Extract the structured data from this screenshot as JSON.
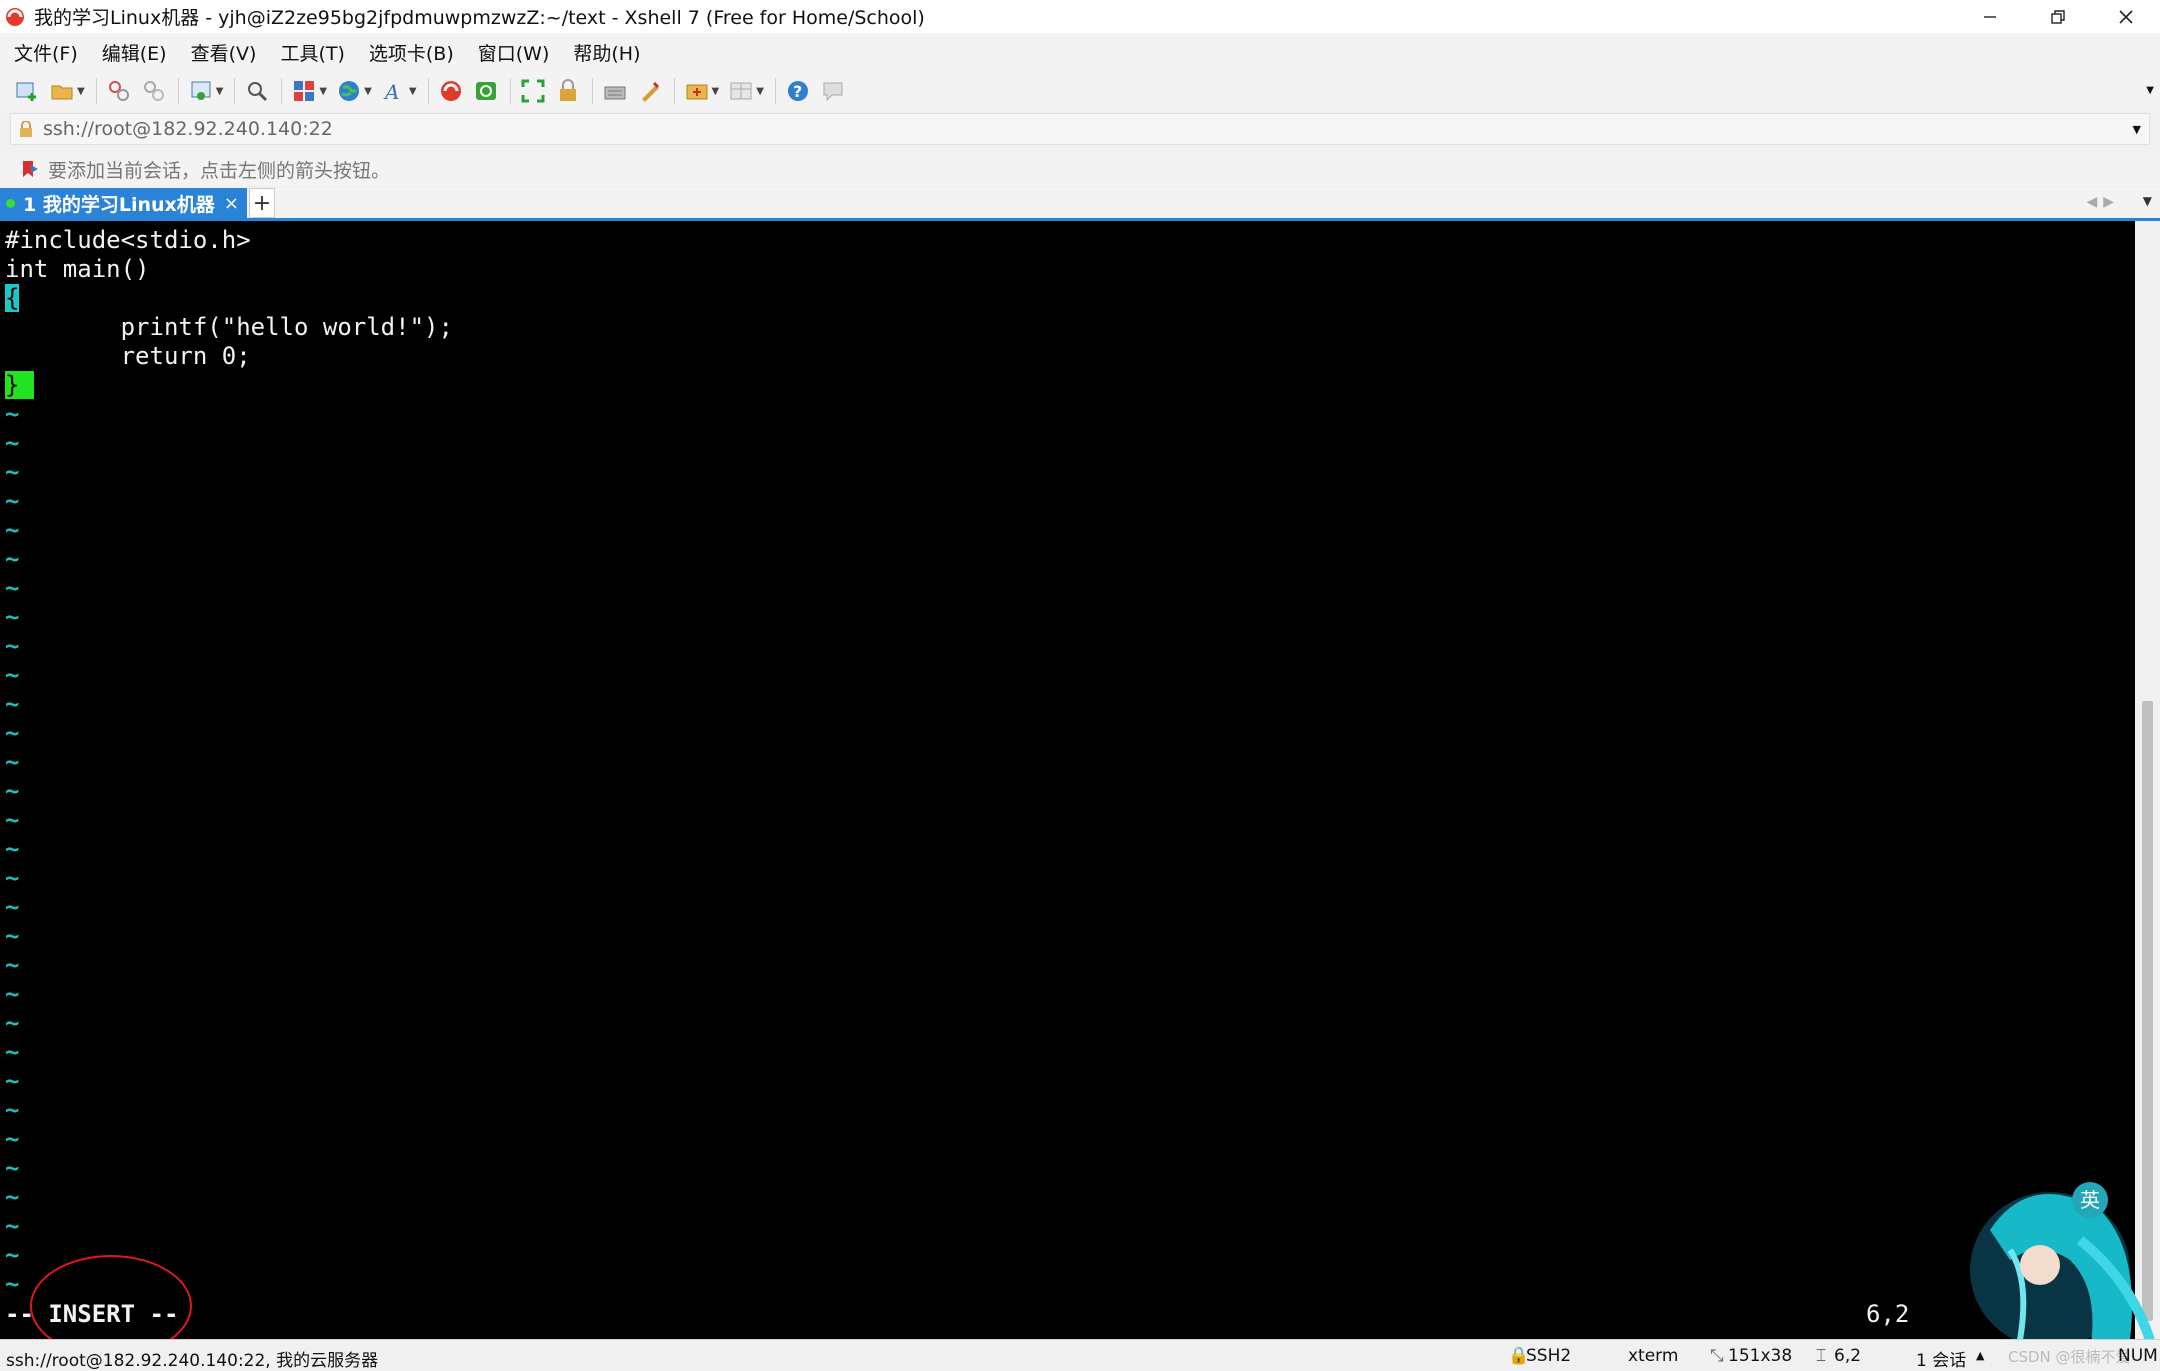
{
  "window": {
    "title": "我的学习Linux机器 - yjh@iZ2ze95bg2jfpdmuwpmzwzZ:~/text - Xshell 7 (Free for Home/School)"
  },
  "menu": [
    "文件(F)",
    "编辑(E)",
    "查看(V)",
    "工具(T)",
    "选项卡(B)",
    "窗口(W)",
    "帮助(H)"
  ],
  "address": {
    "value": "ssh://root@182.92.240.140:22"
  },
  "hint": {
    "text": "要添加当前会话，点击左侧的箭头按钮。"
  },
  "tab": {
    "label": "1 我的学习Linux机器",
    "close": "×",
    "add": "+"
  },
  "editor": {
    "lines": [
      "#include<stdio.h>",
      "int main()",
      "{",
      "        printf(\"hello world!\");",
      "        return 0;",
      "}"
    ],
    "tilde": "~",
    "mode": "-- INSERT --",
    "cursor_pos": "6,2"
  },
  "statusbar": {
    "connection": "ssh://root@182.92.240.140:22, 我的云服务器",
    "protocol": "SSH2",
    "term": "xterm",
    "size": "151x38",
    "pos": "6,2",
    "sessions": "1 会话",
    "num": "NUM",
    "watermark": "CSDN @很楠不爱"
  },
  "mascot": {
    "badge": "英"
  },
  "colors": {
    "accent": "#2a83d6",
    "terminal_bg": "#000000",
    "tilde": "#1fbcbc",
    "cursor_open_brace": "#17c9c9",
    "cursor_close_brace": "#1fe41f",
    "annotation": "#e01818"
  }
}
